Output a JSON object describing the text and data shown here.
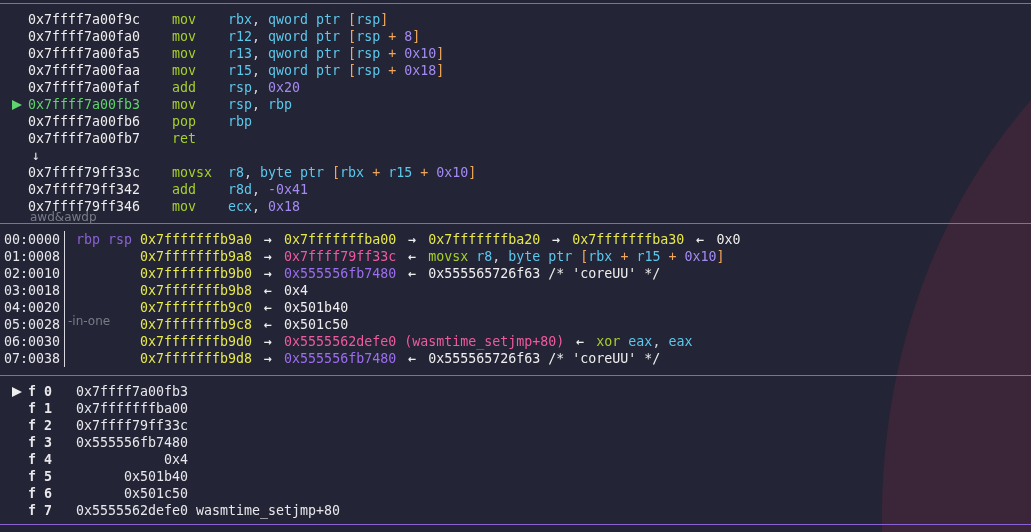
{
  "disassembly": [
    {
      "kind": "instruction",
      "selected": false,
      "address": "0x7ffff7a00f9c",
      "mnemonic": "mov",
      "operands": [
        {
          "text": "rbx",
          "kind": "reg"
        },
        {
          "text": ", ",
          "kind": "punct"
        },
        {
          "text": "qword ptr ",
          "kind": "reg"
        },
        {
          "text": "[",
          "kind": "bracket"
        },
        {
          "text": "rsp",
          "kind": "reg"
        },
        {
          "text": "]",
          "kind": "bracket"
        }
      ]
    },
    {
      "kind": "instruction",
      "selected": false,
      "address": "0x7ffff7a00fa0",
      "mnemonic": "mov",
      "operands": [
        {
          "text": "r12",
          "kind": "reg"
        },
        {
          "text": ", ",
          "kind": "punct"
        },
        {
          "text": "qword ptr ",
          "kind": "reg"
        },
        {
          "text": "[",
          "kind": "bracket"
        },
        {
          "text": "rsp",
          "kind": "reg"
        },
        {
          "text": " + ",
          "kind": "op"
        },
        {
          "text": "8",
          "kind": "num"
        },
        {
          "text": "]",
          "kind": "bracket"
        }
      ]
    },
    {
      "kind": "instruction",
      "selected": false,
      "address": "0x7ffff7a00fa5",
      "mnemonic": "mov",
      "operands": [
        {
          "text": "r13",
          "kind": "reg"
        },
        {
          "text": ", ",
          "kind": "punct"
        },
        {
          "text": "qword ptr ",
          "kind": "reg"
        },
        {
          "text": "[",
          "kind": "bracket"
        },
        {
          "text": "rsp",
          "kind": "reg"
        },
        {
          "text": " + ",
          "kind": "op"
        },
        {
          "text": "0x10",
          "kind": "num"
        },
        {
          "text": "]",
          "kind": "bracket"
        }
      ]
    },
    {
      "kind": "instruction",
      "selected": false,
      "address": "0x7ffff7a00faa",
      "mnemonic": "mov",
      "operands": [
        {
          "text": "r15",
          "kind": "reg"
        },
        {
          "text": ", ",
          "kind": "punct"
        },
        {
          "text": "qword ptr ",
          "kind": "reg"
        },
        {
          "text": "[",
          "kind": "bracket"
        },
        {
          "text": "rsp",
          "kind": "reg"
        },
        {
          "text": " + ",
          "kind": "op"
        },
        {
          "text": "0x18",
          "kind": "num"
        },
        {
          "text": "]",
          "kind": "bracket"
        }
      ]
    },
    {
      "kind": "instruction",
      "selected": false,
      "address": "0x7ffff7a00faf",
      "mnemonic": "add",
      "operands": [
        {
          "text": "rsp",
          "kind": "reg"
        },
        {
          "text": ", ",
          "kind": "punct"
        },
        {
          "text": "0x20",
          "kind": "num"
        }
      ]
    },
    {
      "kind": "instruction",
      "selected": true,
      "address": "0x7ffff7a00fb3",
      "mnemonic": "mov",
      "operands": [
        {
          "text": "rsp",
          "kind": "reg"
        },
        {
          "text": ", ",
          "kind": "punct"
        },
        {
          "text": "rbp",
          "kind": "reg"
        }
      ]
    },
    {
      "kind": "instruction",
      "selected": false,
      "address": "0x7ffff7a00fb6",
      "mnemonic": "pop",
      "operands": [
        {
          "text": "rbp",
          "kind": "reg"
        }
      ]
    },
    {
      "kind": "instruction",
      "selected": false,
      "address": "0x7ffff7a00fb7",
      "mnemonic": "ret"
    },
    {
      "kind": "jump",
      "text": "↓"
    },
    {
      "kind": "instruction",
      "selected": false,
      "address": "0x7ffff79ff33c",
      "mnemonic": "movsx",
      "operands": [
        {
          "text": "r8",
          "kind": "reg"
        },
        {
          "text": ", ",
          "kind": "punct"
        },
        {
          "text": "byte ptr ",
          "kind": "reg"
        },
        {
          "text": "[",
          "kind": "bracket"
        },
        {
          "text": "rbx",
          "kind": "reg"
        },
        {
          "text": " + ",
          "kind": "op"
        },
        {
          "text": "r15",
          "kind": "reg"
        },
        {
          "text": " + ",
          "kind": "op"
        },
        {
          "text": "0x10",
          "kind": "num"
        },
        {
          "text": "]",
          "kind": "bracket"
        }
      ]
    },
    {
      "kind": "instruction",
      "selected": false,
      "address": "0x7ffff79ff342",
      "mnemonic": "add",
      "operands": [
        {
          "text": "r8d",
          "kind": "reg"
        },
        {
          "text": ", ",
          "kind": "punct"
        },
        {
          "text": "-0x41",
          "kind": "num"
        }
      ]
    },
    {
      "kind": "instruction",
      "selected": false,
      "address": "0x7ffff79ff346",
      "mnemonic": "mov",
      "operands": [
        {
          "text": "ecx",
          "kind": "reg"
        },
        {
          "text": ", ",
          "kind": "punct"
        },
        {
          "text": "0x18",
          "kind": "num"
        }
      ]
    }
  ],
  "stack": [
    {
      "offset": "00:0000",
      "registers": "rbp rsp",
      "chain": [
        {
          "text": "0x7fffffffb9a0",
          "kind": "stack"
        },
        {
          "text": " → ",
          "kind": "arrow"
        },
        {
          "text": "0x7fffffffba00",
          "kind": "stack"
        },
        {
          "text": " → ",
          "kind": "arrow"
        },
        {
          "text": "0x7fffffffba20",
          "kind": "stack"
        },
        {
          "text": " → ",
          "kind": "arrow"
        },
        {
          "text": "0x7fffffffba30",
          "kind": "stack"
        },
        {
          "text": " ← ",
          "kind": "arrow"
        },
        {
          "text": "0x0",
          "kind": "plain"
        }
      ]
    },
    {
      "offset": "01:0008",
      "chain": [
        {
          "text": "0x7fffffffb9a8",
          "kind": "stack"
        },
        {
          "text": " → ",
          "kind": "arrow"
        },
        {
          "text": "0x7ffff79ff33c",
          "kind": "code"
        },
        {
          "text": " ← ",
          "kind": "arrow"
        },
        {
          "text": "movsx ",
          "kind": "mnem"
        },
        {
          "text": "r8",
          "kind": "reg"
        },
        {
          "text": ", ",
          "kind": "punct"
        },
        {
          "text": "byte ptr ",
          "kind": "reg"
        },
        {
          "text": "[",
          "kind": "bracket"
        },
        {
          "text": "rbx",
          "kind": "reg"
        },
        {
          "text": " + ",
          "kind": "op"
        },
        {
          "text": "r15",
          "kind": "reg"
        },
        {
          "text": " + ",
          "kind": "op"
        },
        {
          "text": "0x10",
          "kind": "num"
        },
        {
          "text": "]",
          "kind": "bracket"
        }
      ]
    },
    {
      "offset": "02:0010",
      "chain": [
        {
          "text": "0x7fffffffb9b0",
          "kind": "stack"
        },
        {
          "text": " → ",
          "kind": "arrow"
        },
        {
          "text": "0x555556fb7480",
          "kind": "heap"
        },
        {
          "text": " ← ",
          "kind": "arrow"
        },
        {
          "text": "0x555565726f63 /* 'coreUU' */",
          "kind": "plain"
        }
      ]
    },
    {
      "offset": "03:0018",
      "chain": [
        {
          "text": "0x7fffffffb9b8",
          "kind": "stack"
        },
        {
          "text": " ← ",
          "kind": "arrow"
        },
        {
          "text": "0x4",
          "kind": "plain"
        }
      ]
    },
    {
      "offset": "04:0020",
      "chain": [
        {
          "text": "0x7fffffffb9c0",
          "kind": "stack"
        },
        {
          "text": " ← ",
          "kind": "arrow"
        },
        {
          "text": "0x501b40",
          "kind": "plain"
        }
      ]
    },
    {
      "offset": "05:0028",
      "chain": [
        {
          "text": "0x7fffffffb9c8",
          "kind": "stack"
        },
        {
          "text": " ← ",
          "kind": "arrow"
        },
        {
          "text": "0x501c50",
          "kind": "plain"
        }
      ]
    },
    {
      "offset": "06:0030",
      "chain": [
        {
          "text": "0x7fffffffb9d0",
          "kind": "stack"
        },
        {
          "text": " → ",
          "kind": "arrow"
        },
        {
          "text": "0x5555562defe0 (wasmtime_setjmp+80)",
          "kind": "code"
        },
        {
          "text": " ← ",
          "kind": "arrow"
        },
        {
          "text": "xor ",
          "kind": "mnem"
        },
        {
          "text": "eax",
          "kind": "reg"
        },
        {
          "text": ", ",
          "kind": "punct"
        },
        {
          "text": "eax",
          "kind": "reg"
        }
      ]
    },
    {
      "offset": "07:0038",
      "chain": [
        {
          "text": "0x7fffffffb9d8",
          "kind": "stack"
        },
        {
          "text": " → ",
          "kind": "arrow"
        },
        {
          "text": "0x555556fb7480",
          "kind": "heap"
        },
        {
          "text": " ← ",
          "kind": "arrow"
        },
        {
          "text": "0x555565726f63 /* 'coreUU' */",
          "kind": "plain"
        }
      ]
    }
  ],
  "backtrace": [
    {
      "frame": "f 0",
      "selected": true,
      "address": "0x7ffff7a00fb3"
    },
    {
      "frame": "f 1",
      "selected": false,
      "address": "0x7fffffffba00"
    },
    {
      "frame": "f 2",
      "selected": false,
      "address": "0x7ffff79ff33c"
    },
    {
      "frame": "f 3",
      "selected": false,
      "address": "0x555556fb7480"
    },
    {
      "frame": "f 4",
      "selected": false,
      "address": "0x4"
    },
    {
      "frame": "f 5",
      "selected": false,
      "address": "0x501b40"
    },
    {
      "frame": "f 6",
      "selected": false,
      "address": "0x501c50"
    },
    {
      "frame": "f 7",
      "selected": false,
      "address": "0x5555562defe0",
      "symbol": "wasmtime_setjmp+80"
    }
  ],
  "desktop_labels": [
    "awd&awdp",
    "-in-one"
  ]
}
